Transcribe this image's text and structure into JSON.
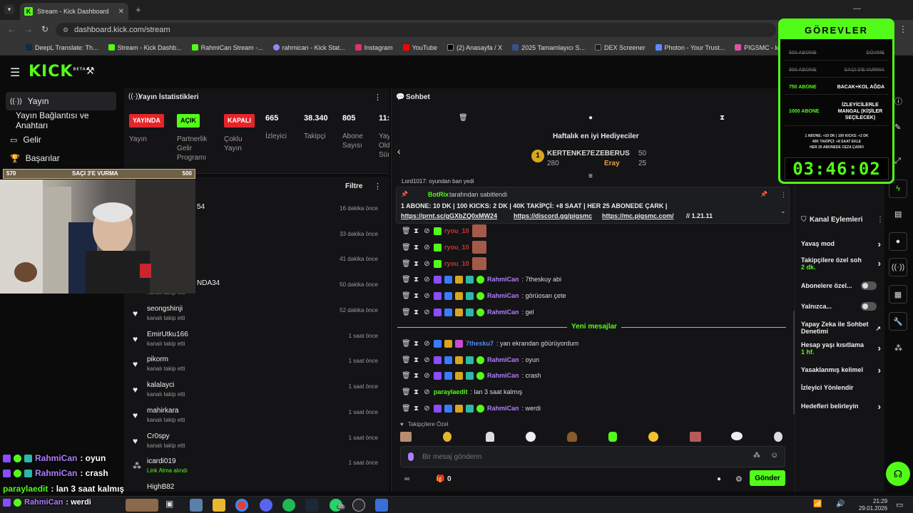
{
  "browser": {
    "tab_title": "Stream - Kick Dashboard",
    "url": "dashboard.kick.com/stream",
    "bookmarks": [
      "DeepL Translate: Th...",
      "Stream - Kick Dashb...",
      "RahmiCan Stream -...",
      "rahmican - Kick Stat...",
      "Instagram",
      "YouTube",
      "(2) Anasayfa / X",
      "2025 Tamamlayıcı S...",
      "DEX Screener",
      "Photon - Your Trust...",
      "PIGSMC - kick.com/...",
      "uxento"
    ]
  },
  "nav": {
    "logo": "KICK",
    "logo_sup": "BETA",
    "items": [
      "Yayın",
      "Yayın Bağlantısı ve Anahtarı",
      "Gelir",
      "Başarılar"
    ]
  },
  "stats": {
    "title": "Yayın İstatistikleri",
    "cols": [
      {
        "badge": "YAYINDA",
        "label": "Yayın"
      },
      {
        "badge": "AÇIK",
        "label": "Partnerlik Gelir Programı"
      },
      {
        "badge": "KAPALI",
        "label": "Çoklu Yayın"
      },
      {
        "value": "665",
        "label": "İzleyici"
      },
      {
        "value": "38.340",
        "label": "Takipçi"
      },
      {
        "value": "805",
        "label": "Abone Sayısı"
      },
      {
        "value": "11:",
        "label": "Yay Old Süı"
      }
    ]
  },
  "followers": {
    "filter": "Filtre",
    "rows": [
      {
        "name": "54",
        "sub": "",
        "time": "16 dakika önce"
      },
      {
        "name": "",
        "sub": "",
        "time": "33 dakika önce"
      },
      {
        "name": "",
        "sub": "",
        "time": "41 dakika önce"
      },
      {
        "name": "NDA34",
        "sub": "kanalı takip etti",
        "time": "50 dakika önce"
      },
      {
        "name": "seongshinji",
        "sub": "kanalı takip etti",
        "time": "52 dakika önce"
      },
      {
        "name": "EmirUtku166",
        "sub": "kanalı takip etti",
        "time": "1 saat önce"
      },
      {
        "name": "pikorm",
        "sub": "kanalı takip etti",
        "time": "1 saat önce"
      },
      {
        "name": "kalalayci",
        "sub": "kanalı takip etti",
        "time": "1 saat önce"
      },
      {
        "name": "mahirkara",
        "sub": "kanalı takip etti",
        "time": "1 saat önce"
      },
      {
        "name": "Cr0spy",
        "sub": "kanalı takip etti",
        "time": "1 saat önce"
      },
      {
        "name": "icardi019",
        "sub": "Link Atma alındı",
        "time": "1 saat önce"
      },
      {
        "name": "HighB82",
        "sub": "",
        "time": ""
      }
    ]
  },
  "chat": {
    "title": "Sohbet",
    "gifters_title": "Haftalık en iyi Hediyeciler",
    "gifters": [
      {
        "name": "KERTENKE7E",
        "amount": "280"
      },
      {
        "name": "ZEBERUS",
        "amount": "50"
      },
      {
        "name": "Eray",
        "amount": "25"
      }
    ],
    "partial_line": "Lord1017: oyundan ban yedi",
    "pinned_by": "BotRix",
    "pinned_suffix": "tarafından sabitlendi",
    "pinned_line1": "1 ABONE: 10 DK | 100 KICKS: 2 DK | 40K TAKİPÇİ: +8 SAAT | HER 25 ABONEDE ÇARK |",
    "pinned_link1": "https://prnt.sc/gGXbZQ0xMW24",
    "pinned_link2": "https://discord.gg/pigsmc",
    "pinned_link3": "https://mc.pigsmc.com/",
    "pinned_ver": "// 1.21.11",
    "messages_old": [
      {
        "user": "ryou_10",
        "text": "",
        "color": "#d0332f"
      },
      {
        "user": "ryou_10",
        "text": "",
        "color": "#d0332f"
      },
      {
        "user": "ryou_10",
        "text": "",
        "color": "#d0332f"
      },
      {
        "user": "RahmiCan",
        "text": ": 7theskuy abi",
        "color": "#b07cff"
      },
      {
        "user": "RahmiCan",
        "text": ": görüosan çete",
        "color": "#b07cff"
      },
      {
        "user": "RahmiCan",
        "text": ": gel",
        "color": "#b07cff"
      }
    ],
    "new_messages_label": "Yeni mesajlar",
    "messages_new": [
      {
        "user": "7thesku7",
        "text": ": yan ekrandan göürüyordum",
        "color": "#4a8cff"
      },
      {
        "user": "RahmiCan",
        "text": ": oyun",
        "color": "#b07cff"
      },
      {
        "user": "RahmiCan",
        "text": ": crash",
        "color": "#b07cff"
      },
      {
        "user": "paraylaedit",
        "text": ": lan 3 saat kalmış",
        "color": "#53fc18"
      },
      {
        "user": "RahmiCan",
        "text": ": werdi",
        "color": "#b07cff"
      }
    ],
    "followers_only": "Takipçilere Özel",
    "input_placeholder": "Bir mesaj gönderin",
    "points": "0",
    "send": "Gönder"
  },
  "channel_actions": {
    "title": "Kanal Eylemleri",
    "items": [
      {
        "label": "Yavaş mod",
        "sub": ""
      },
      {
        "label": "Takipçilere özel soh",
        "sub": "2 dk."
      },
      {
        "label": "Abonelere özel...",
        "sub": ""
      },
      {
        "label": "Yalnızca...",
        "sub": ""
      },
      {
        "label": "Yapay Zeka ile Sohbet Denetimi",
        "sub": ""
      },
      {
        "label": "Hesap yaşı kısıtlama",
        "sub": "1 hf."
      },
      {
        "label": "Yasaklanmış kelimel",
        "sub": ""
      },
      {
        "label": "İzleyici Yönlendir",
        "sub": ""
      },
      {
        "label": "Hedefleri belirleyin",
        "sub": ""
      }
    ]
  },
  "goals": {
    "title": "GÖREVLER",
    "rows": [
      {
        "left": "500 ABONE",
        "right": "DÖVME",
        "done": true
      },
      {
        "left": "800 ABONE",
        "right": "SAÇI 3'E VURMA",
        "done": true
      },
      {
        "left": "750 ABONE",
        "right": "BACAK+KOL AĞDA",
        "done": false
      },
      {
        "left": "1000 ABONE",
        "right": "İZLEYİCİLERLE MANGAL (KİŞİLER SEÇİLECEK)",
        "done": false
      }
    ],
    "rules1": "1 ABONE: +10 DK | 100 KICKS: +2 DK",
    "rules2": "40K TAKİPÇİ: +8 SAAT EKLE",
    "rules3": "HER 25 ABONEDE CEZA ÇARKI",
    "timer": "03:46:02"
  },
  "progress": {
    "current": "570",
    "label": "SAÇI 3'E VURMA",
    "target": "500",
    "fill": 1.0
  },
  "overlay_chat": [
    {
      "user": "RahmiCan",
      "text": ": oyun",
      "color": "#b07cff"
    },
    {
      "user": "RahmiCan",
      "text": ": crash",
      "color": "#b07cff"
    },
    {
      "user": "paraylaedit",
      "text": ": lan 3 saat kalmış",
      "color": "#53fc18"
    },
    {
      "user": "RahmiCan",
      "text": ": werdi",
      "color": "#b07cff"
    }
  ],
  "taskbar": {
    "time": "21:29",
    "date": "29.01.2026",
    "badge": "85"
  },
  "colors": {
    "accent": "#53fc18",
    "live": "#e5252a",
    "bg": "#0b0b0c",
    "panel": "#141416"
  }
}
